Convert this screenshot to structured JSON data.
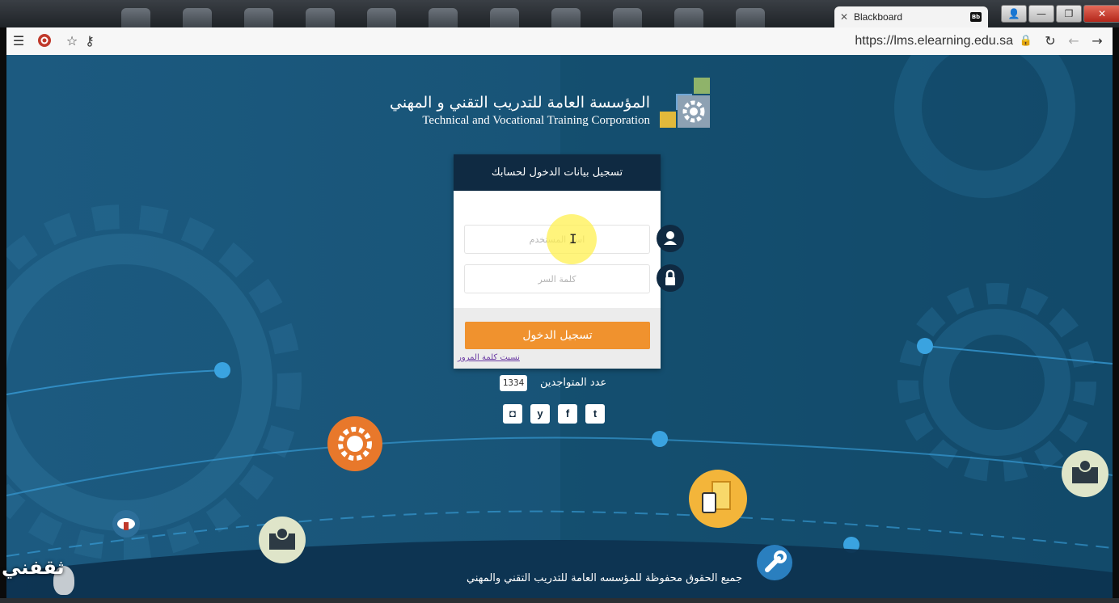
{
  "browser": {
    "tab_title": "Blackboard",
    "tab_close": "✕",
    "tab_favicon": "Bb",
    "url": "https://lms.elearning.edu.sa",
    "icons": [
      "menu-icon",
      "record-icon",
      "star-icon",
      "key-icon",
      "lock-icon",
      "reload-icon",
      "back-icon",
      "forward-icon"
    ],
    "window_buttons": {
      "user": "👤",
      "minimize": "—",
      "maximize": "❐",
      "close": "✕"
    }
  },
  "logo": {
    "arabic": "المؤسسة العامة للتدريب التقني و المهني",
    "english": "Technical and Vocational Training Corporation"
  },
  "login": {
    "title": "تسجيل بيانات الدخول لحسابك",
    "username_placeholder": "اسم المستخدم",
    "password_placeholder": "كلمة السر",
    "submit_label": "تسجيل الدخول",
    "forgot_link": "نسيت كلمة المرور"
  },
  "online": {
    "label": "عدد المتواجدين",
    "count": "1334"
  },
  "social": [
    {
      "name": "instagram",
      "glyph": "◘"
    },
    {
      "name": "yammer",
      "glyph": "y"
    },
    {
      "name": "facebook",
      "glyph": "f"
    },
    {
      "name": "twitter",
      "glyph": "t"
    }
  ],
  "footer": {
    "copyright": "جميع الحقوق محفوظة للمؤسسه العامة للتدريب التقني والمهني"
  },
  "watermark": "ثقفني",
  "colors": {
    "page_bg": "#1a5a80",
    "panel_header": "#0f2a42",
    "login_button": "#f0922e",
    "accent_dot": "#3aa3e0",
    "logo_green": "#8fb36a",
    "logo_yellow": "#e2b93b",
    "logo_blue": "#6fa6d6"
  }
}
